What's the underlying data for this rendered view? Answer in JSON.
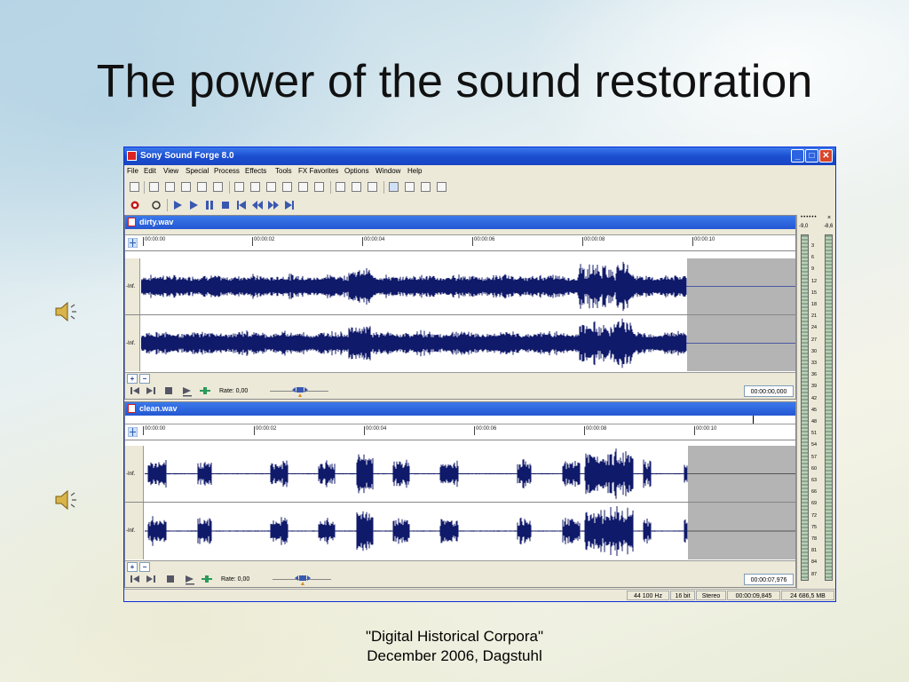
{
  "slide": {
    "title": "The power of the sound restoration",
    "footer_line1": "\"Digital Historical Corpora\"",
    "footer_line2": "December 2006, Dagstuhl"
  },
  "app": {
    "title": "Sony Sound Forge 8.0",
    "menu": [
      "File",
      "Edit",
      "View",
      "Special",
      "Process",
      "Effects",
      "Tools",
      "FX Favorites",
      "Options",
      "Window",
      "Help"
    ],
    "window_buttons": {
      "minimize": "_",
      "maximize": "□",
      "close": "✕"
    }
  },
  "windows": [
    {
      "name": "dirty.wav",
      "ruler": [
        "00:00:00",
        "00:00:02",
        "00:00:04",
        "00:00:06",
        "00:00:08",
        "00:00:10"
      ],
      "channel_label": "-Inf.",
      "rate_label": "Rate: 0,00",
      "time": "00:00:00,000",
      "zoom_in": "+",
      "zoom_out": "−"
    },
    {
      "name": "clean.wav",
      "ruler": [
        "00:00:00",
        "00:00:02",
        "00:00:04",
        "00:00:06",
        "00:00:08",
        "00:00:10"
      ],
      "channel_label": "-Inf.",
      "rate_label": "Rate: 0,00",
      "time": "00:00:07,976",
      "zoom_in": "+",
      "zoom_out": "−"
    }
  ],
  "meter": {
    "left_peak": "-9,0",
    "right_peak": "-8,6",
    "scale": [
      "3",
      "6",
      "9",
      "12",
      "15",
      "18",
      "21",
      "24",
      "27",
      "30",
      "33",
      "36",
      "39",
      "42",
      "45",
      "48",
      "51",
      "54",
      "57",
      "60",
      "63",
      "66",
      "69",
      "72",
      "75",
      "78",
      "81",
      "84",
      "87"
    ]
  },
  "status": {
    "sample_rate": "44 100 Hz",
    "bit_depth": "16 bit",
    "channels": "Stereo",
    "length": "00:00:09,845",
    "disk": "24 686,5 MB"
  },
  "colors": {
    "waveform": "#101a6a",
    "titlebar": "#2457d2",
    "selection_gray": "#b4b4b4"
  }
}
